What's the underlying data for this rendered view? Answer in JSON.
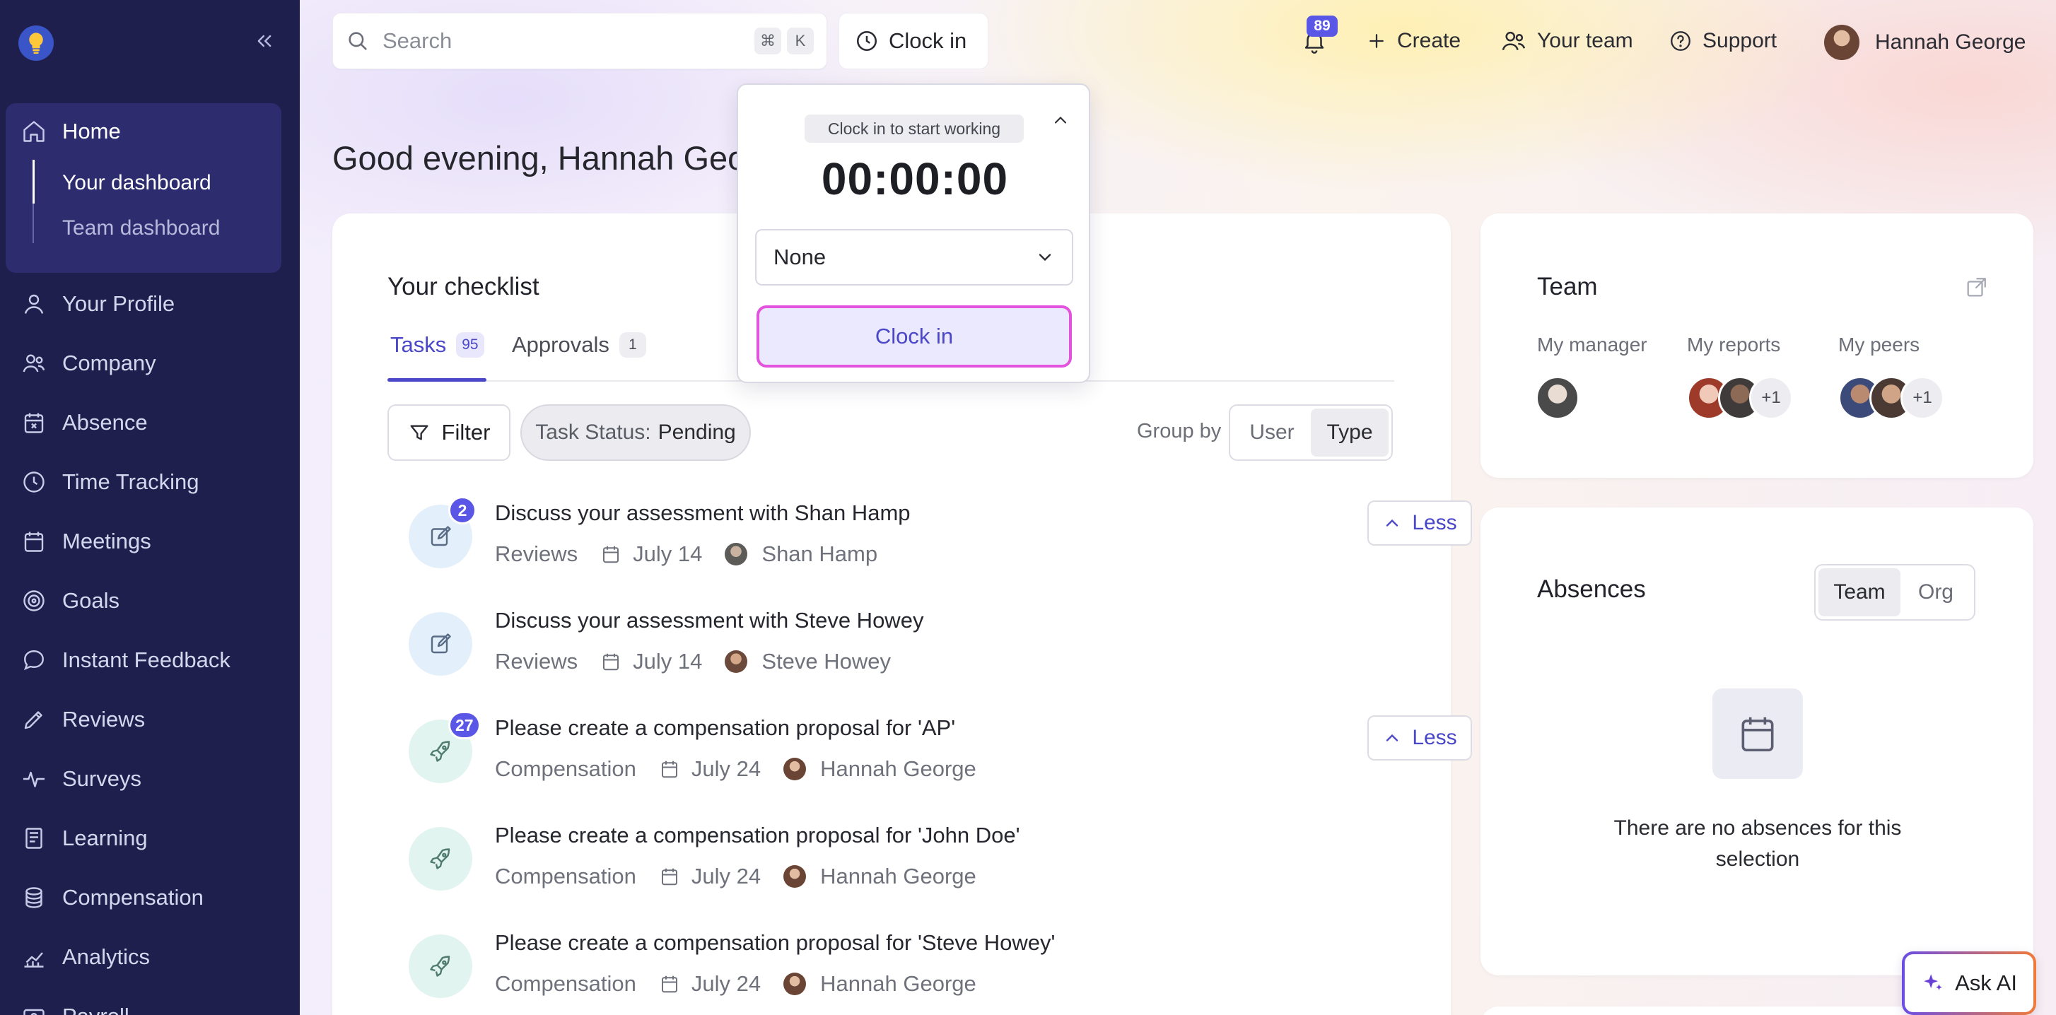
{
  "sidebar": {
    "nav": [
      {
        "label": "Home",
        "icon": "home-icon"
      },
      {
        "label": "Your Profile",
        "icon": "user-icon"
      },
      {
        "label": "Company",
        "icon": "users-icon"
      },
      {
        "label": "Absence",
        "icon": "calendar-x-icon"
      },
      {
        "label": "Time Tracking",
        "icon": "clock-icon"
      },
      {
        "label": "Meetings",
        "icon": "calendar-icon"
      },
      {
        "label": "Goals",
        "icon": "target-icon"
      },
      {
        "label": "Instant Feedback",
        "icon": "chat-icon"
      },
      {
        "label": "Reviews",
        "icon": "pencil-icon"
      },
      {
        "label": "Surveys",
        "icon": "pulse-icon"
      },
      {
        "label": "Learning",
        "icon": "book-icon"
      },
      {
        "label": "Compensation",
        "icon": "coins-icon"
      },
      {
        "label": "Analytics",
        "icon": "chart-icon"
      },
      {
        "label": "Payroll",
        "icon": "payroll-icon"
      }
    ],
    "home_sub": [
      "Your dashboard",
      "Team dashboard"
    ]
  },
  "topbar": {
    "search_placeholder": "Search",
    "kbd_cmd": "⌘",
    "kbd_k": "K",
    "clock_in": "Clock in",
    "notifications": "89",
    "create": "Create",
    "your_team": "Your team",
    "support": "Support",
    "user_name": "Hannah George"
  },
  "greeting": "Good evening, Hannah Geor",
  "checklist": {
    "title": "Your checklist",
    "tabs": [
      {
        "label": "Tasks",
        "count": "95"
      },
      {
        "label": "Approvals",
        "count": "1"
      }
    ],
    "filter": "Filter",
    "status_prefix": "Task Status:",
    "status_value": "Pending",
    "group_by": "Group by",
    "group_options": [
      "User",
      "Type"
    ],
    "less": "Less",
    "tasks": [
      {
        "title": "Discuss your assessment with Shan Hamp",
        "type": "Reviews",
        "date": "July 14",
        "person": "Shan Hamp",
        "badge": "2"
      },
      {
        "title": "Discuss your assessment with Steve Howey",
        "type": "Reviews",
        "date": "July 14",
        "person": "Steve Howey",
        "badge": ""
      },
      {
        "title": "Please create a compensation proposal for 'AP'",
        "type": "Compensation",
        "date": "July 24",
        "person": "Hannah George",
        "badge": "27"
      },
      {
        "title": "Please create a compensation proposal for 'John Doe'",
        "type": "Compensation",
        "date": "July 24",
        "person": "Hannah George",
        "badge": ""
      },
      {
        "title": "Please create a compensation proposal for 'Steve Howey'",
        "type": "Compensation",
        "date": "July 24",
        "person": "Hannah George",
        "badge": ""
      }
    ]
  },
  "popover": {
    "chip": "Clock in to start working",
    "timer": "00:00:00",
    "select_value": "None",
    "button": "Clock in"
  },
  "team": {
    "title": "Team",
    "my_manager": "My manager",
    "my_reports": "My reports",
    "my_peers": "My peers",
    "reports_more": "+1",
    "peers_more": "+1"
  },
  "absences": {
    "title": "Absences",
    "toggle": [
      "Team",
      "Org"
    ],
    "empty": "There are no absences for this selection"
  },
  "ask_ai": "Ask AI",
  "colors": {
    "sidebar_bg": "#1f1f4d",
    "accent": "#4a47c9",
    "badge": "#5b57e6",
    "clockin_border": "#e353dd"
  }
}
